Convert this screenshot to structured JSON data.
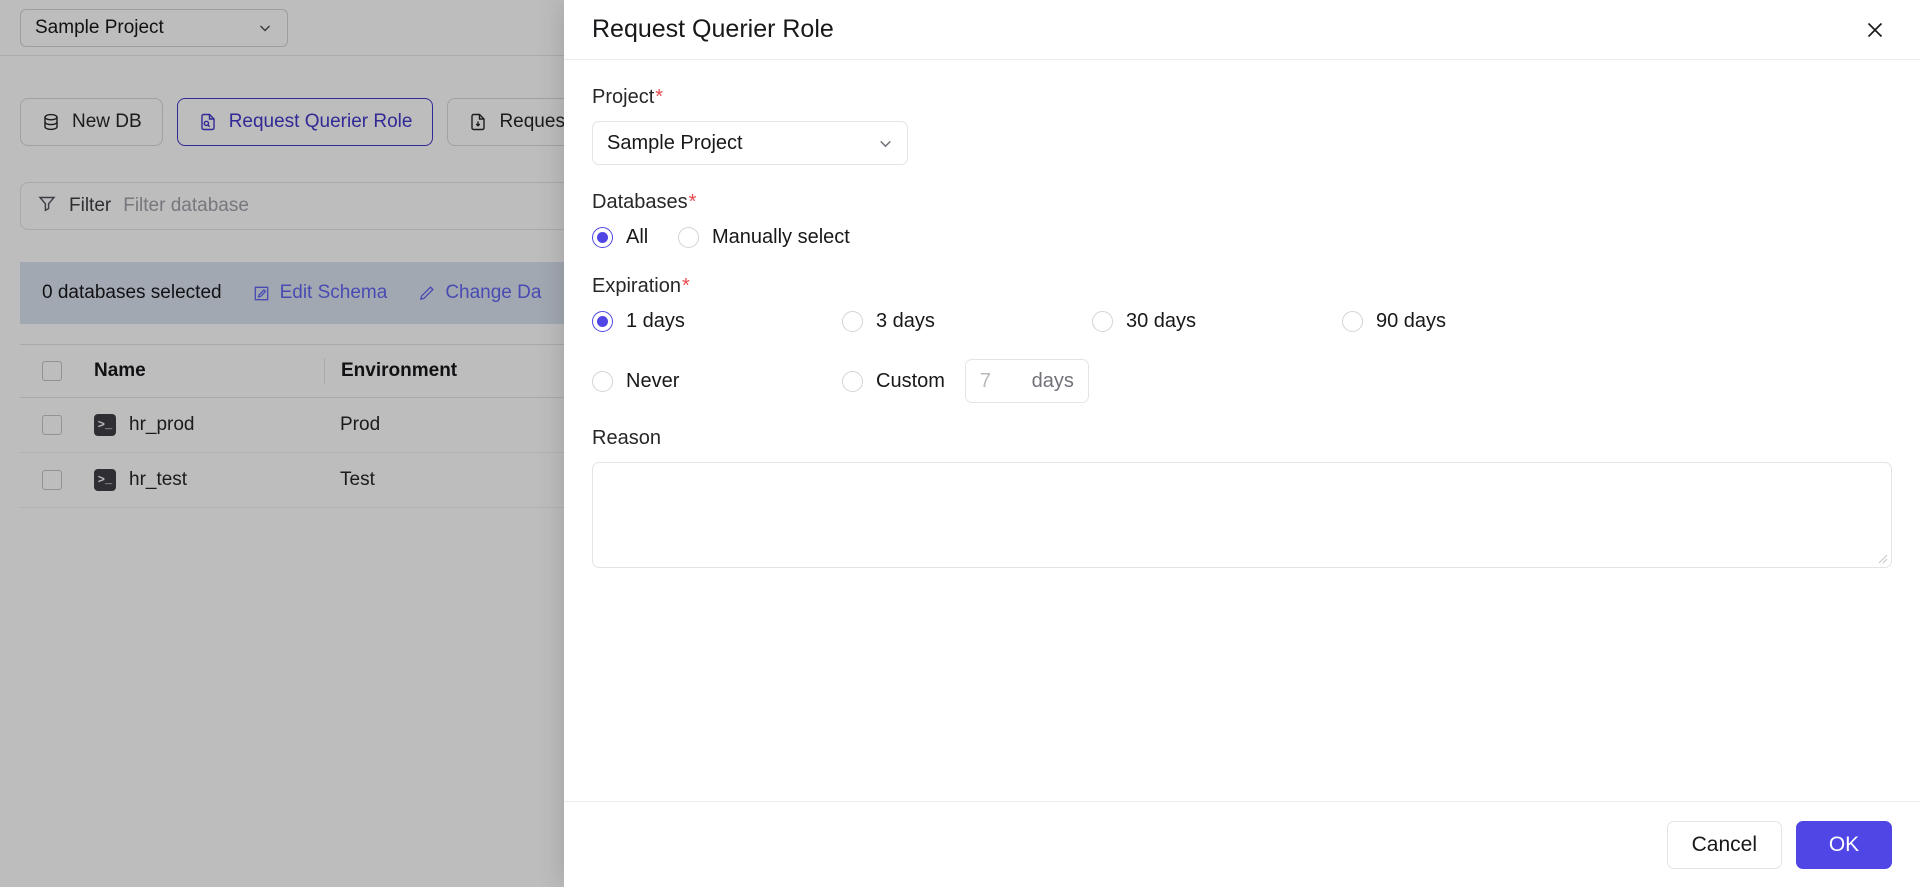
{
  "background": {
    "project_selector": {
      "value": "Sample Project",
      "icon": "chevron-down-icon"
    },
    "toolbar": [
      {
        "label": "New DB",
        "icon": "database-icon",
        "active": false
      },
      {
        "label": "Request Querier Role",
        "icon": "file-search-icon",
        "active": true
      },
      {
        "label": "Request",
        "icon": "file-download-icon",
        "active": false
      }
    ],
    "filter": {
      "label": "Filter",
      "placeholder": "Filter database",
      "icon": "funnel-icon"
    },
    "selection_banner": {
      "count_text": "0 databases selected",
      "actions": [
        {
          "label": "Edit Schema",
          "icon": "edit-square-icon"
        },
        {
          "label": "Change Da",
          "icon": "pencil-icon"
        }
      ]
    },
    "table": {
      "columns": [
        "Name",
        "Environment"
      ],
      "rows": [
        {
          "name": "hr_prod",
          "environment": "Prod",
          "icon": "terminal-icon"
        },
        {
          "name": "hr_test",
          "environment": "Test",
          "icon": "terminal-icon"
        }
      ]
    }
  },
  "modal": {
    "title": "Request Querier Role",
    "close_icon": "close-icon",
    "project": {
      "label": "Project",
      "required_mark": "*",
      "value": "Sample Project",
      "icon": "chevron-down-icon"
    },
    "databases": {
      "label": "Databases",
      "required_mark": "*",
      "options": [
        {
          "label": "All",
          "selected": true
        },
        {
          "label": "Manually select",
          "selected": false
        }
      ]
    },
    "expiration": {
      "label": "Expiration",
      "required_mark": "*",
      "options": [
        {
          "label": "1 days",
          "selected": true
        },
        {
          "label": "3 days",
          "selected": false
        },
        {
          "label": "30 days",
          "selected": false
        },
        {
          "label": "90 days",
          "selected": false
        },
        {
          "label": "Never",
          "selected": false
        },
        {
          "label": "Custom",
          "selected": false
        }
      ],
      "custom_input": {
        "placeholder": "7",
        "suffix": "days",
        "value": ""
      }
    },
    "reason": {
      "label": "Reason",
      "value": "",
      "placeholder": ""
    },
    "footer": {
      "cancel_label": "Cancel",
      "ok_label": "OK"
    }
  },
  "colors": {
    "accent": "#4f46e5",
    "accent_dark": "#4338ca",
    "required": "#e5484d",
    "banner": "#dbe3f0"
  }
}
